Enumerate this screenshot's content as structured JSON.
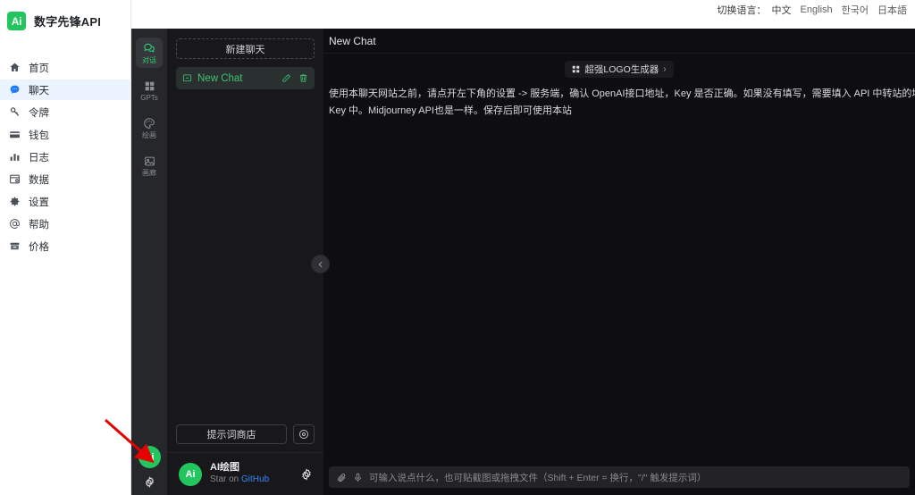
{
  "brand": {
    "logo_text": "Ai",
    "name": "数字先锋API"
  },
  "language_bar": {
    "label": "切换语言：",
    "options": [
      {
        "text": "中文",
        "selected": true
      },
      {
        "text": "English",
        "selected": false
      },
      {
        "text": "한국어",
        "selected": false
      },
      {
        "text": "日本語",
        "selected": false
      }
    ]
  },
  "sidebar": {
    "items": [
      {
        "label": "首页",
        "icon": "home-icon",
        "active": false
      },
      {
        "label": "聊天",
        "icon": "chat-bubble-icon",
        "active": true
      },
      {
        "label": "令牌",
        "icon": "key-icon",
        "active": false
      },
      {
        "label": "钱包",
        "icon": "wallet-icon",
        "active": false
      },
      {
        "label": "日志",
        "icon": "bar-chart-icon",
        "active": false
      },
      {
        "label": "数据",
        "icon": "database-icon",
        "active": false
      },
      {
        "label": "设置",
        "icon": "gear-icon",
        "active": false
      },
      {
        "label": "帮助",
        "icon": "at-sign-icon",
        "active": false
      },
      {
        "label": "价格",
        "icon": "price-tag-icon",
        "active": false
      }
    ]
  },
  "icon_rail": {
    "items": [
      {
        "label": "对话",
        "icon": "chat-bubbles-icon",
        "active": true
      },
      {
        "label": "GPTs",
        "icon": "grid-squares-icon",
        "active": false
      },
      {
        "label": "绘画",
        "icon": "palette-icon",
        "active": false
      },
      {
        "label": "画廊",
        "icon": "image-icon",
        "active": false
      }
    ],
    "avatar_text": "Ai",
    "settings_icon": "gear-icon"
  },
  "chat_list": {
    "new_chat_label": "新建聊天",
    "conversations": [
      {
        "title": "New Chat",
        "active": true,
        "edit_icon": "pencil-icon",
        "delete_icon": "trash-icon"
      }
    ],
    "prompt_store_label": "提示词商店",
    "prompt_config_icon": "settings-circle-icon",
    "user": {
      "avatar_text": "Ai",
      "name": "AI绘图",
      "sub_prefix": "Star on ",
      "sub_link": "GitHub",
      "gear_icon": "gear-icon"
    },
    "collapse_icon": "chevron-left-icon"
  },
  "main": {
    "title": "New Chat",
    "promo": {
      "label": "超强LOGO生成器",
      "chevron": "›",
      "icon": "grid-icon"
    },
    "intro_line1": "使用本聊天网站之前，请点开左下角的设置 -> 服务端，确认 OpenAI接口地址，Key 是否正确。如果没有填写，需要填入 API 中转站的地址，例如：https://api.op",
    "intro_line2": "Key 中。Midjourney API也是一样。保存后即可使用本站",
    "composer": {
      "attach_icon": "paperclip-icon",
      "mic_icon": "microphone-icon",
      "placeholder": "可输入说点什么，也可贴截图或拖拽文件（Shift + Enter = 换行，\"/\" 触发提示词）"
    }
  },
  "annotation": {
    "arrow_color": "#e60000",
    "target": "icon-rail-settings-gear"
  },
  "colors": {
    "brand_green": "#22c55e",
    "accent_green": "#41c06f",
    "sidebar_active_bg": "#eaf3fe",
    "sidebar_active_icon": "#1d7afc",
    "rail_bg": "#26272b",
    "chat_list_bg": "#18181b",
    "main_bg": "#0e0e11",
    "link_blue": "#3b82f6"
  }
}
